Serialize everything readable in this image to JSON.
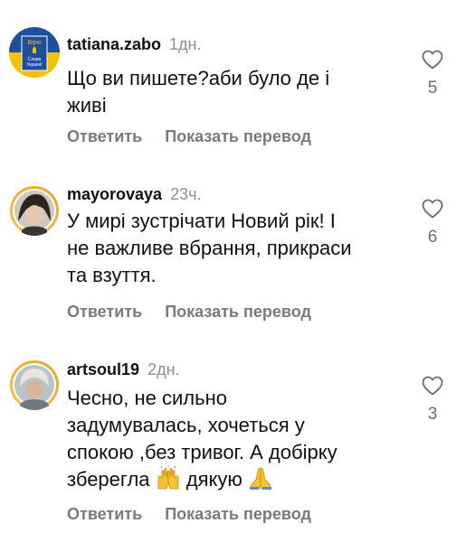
{
  "comments": [
    {
      "username": "tatiana.zabo",
      "time": "1дн.",
      "lines": [
        "Що ви пишете?аби було де і",
        "живі"
      ],
      "likes": "5",
      "avatar_text": [
        "Вірю",
        "Слава",
        "Україні!"
      ]
    },
    {
      "username": "mayorovaya",
      "time": "23ч.",
      "lines": [
        "У мирі зустрічати Новий рік! І",
        "не важливе вбрання, прикраси",
        "та взуття."
      ],
      "likes": "6"
    },
    {
      "username": "artsoul19",
      "time": "2дн.",
      "lines": [
        "Чесно, не сильно",
        "задумувалась, хочеться у",
        "спокою ,без тривог. А добірку"
      ],
      "last_line_a": "зберегла",
      "last_line_b": "дякую",
      "likes": "3"
    }
  ],
  "actions": {
    "reply": "Ответить",
    "translate": "Показать перевод"
  },
  "icons": {
    "like": "heart-outline-icon",
    "raised_hands": "raising-hands-emoji",
    "folded_hands": "folded-hands-emoji"
  },
  "colors": {
    "avatar_flag_blue": "#1d4f9c",
    "avatar_flag_yellow": "#f2c200",
    "secondary_text": "#8e8e8e"
  }
}
